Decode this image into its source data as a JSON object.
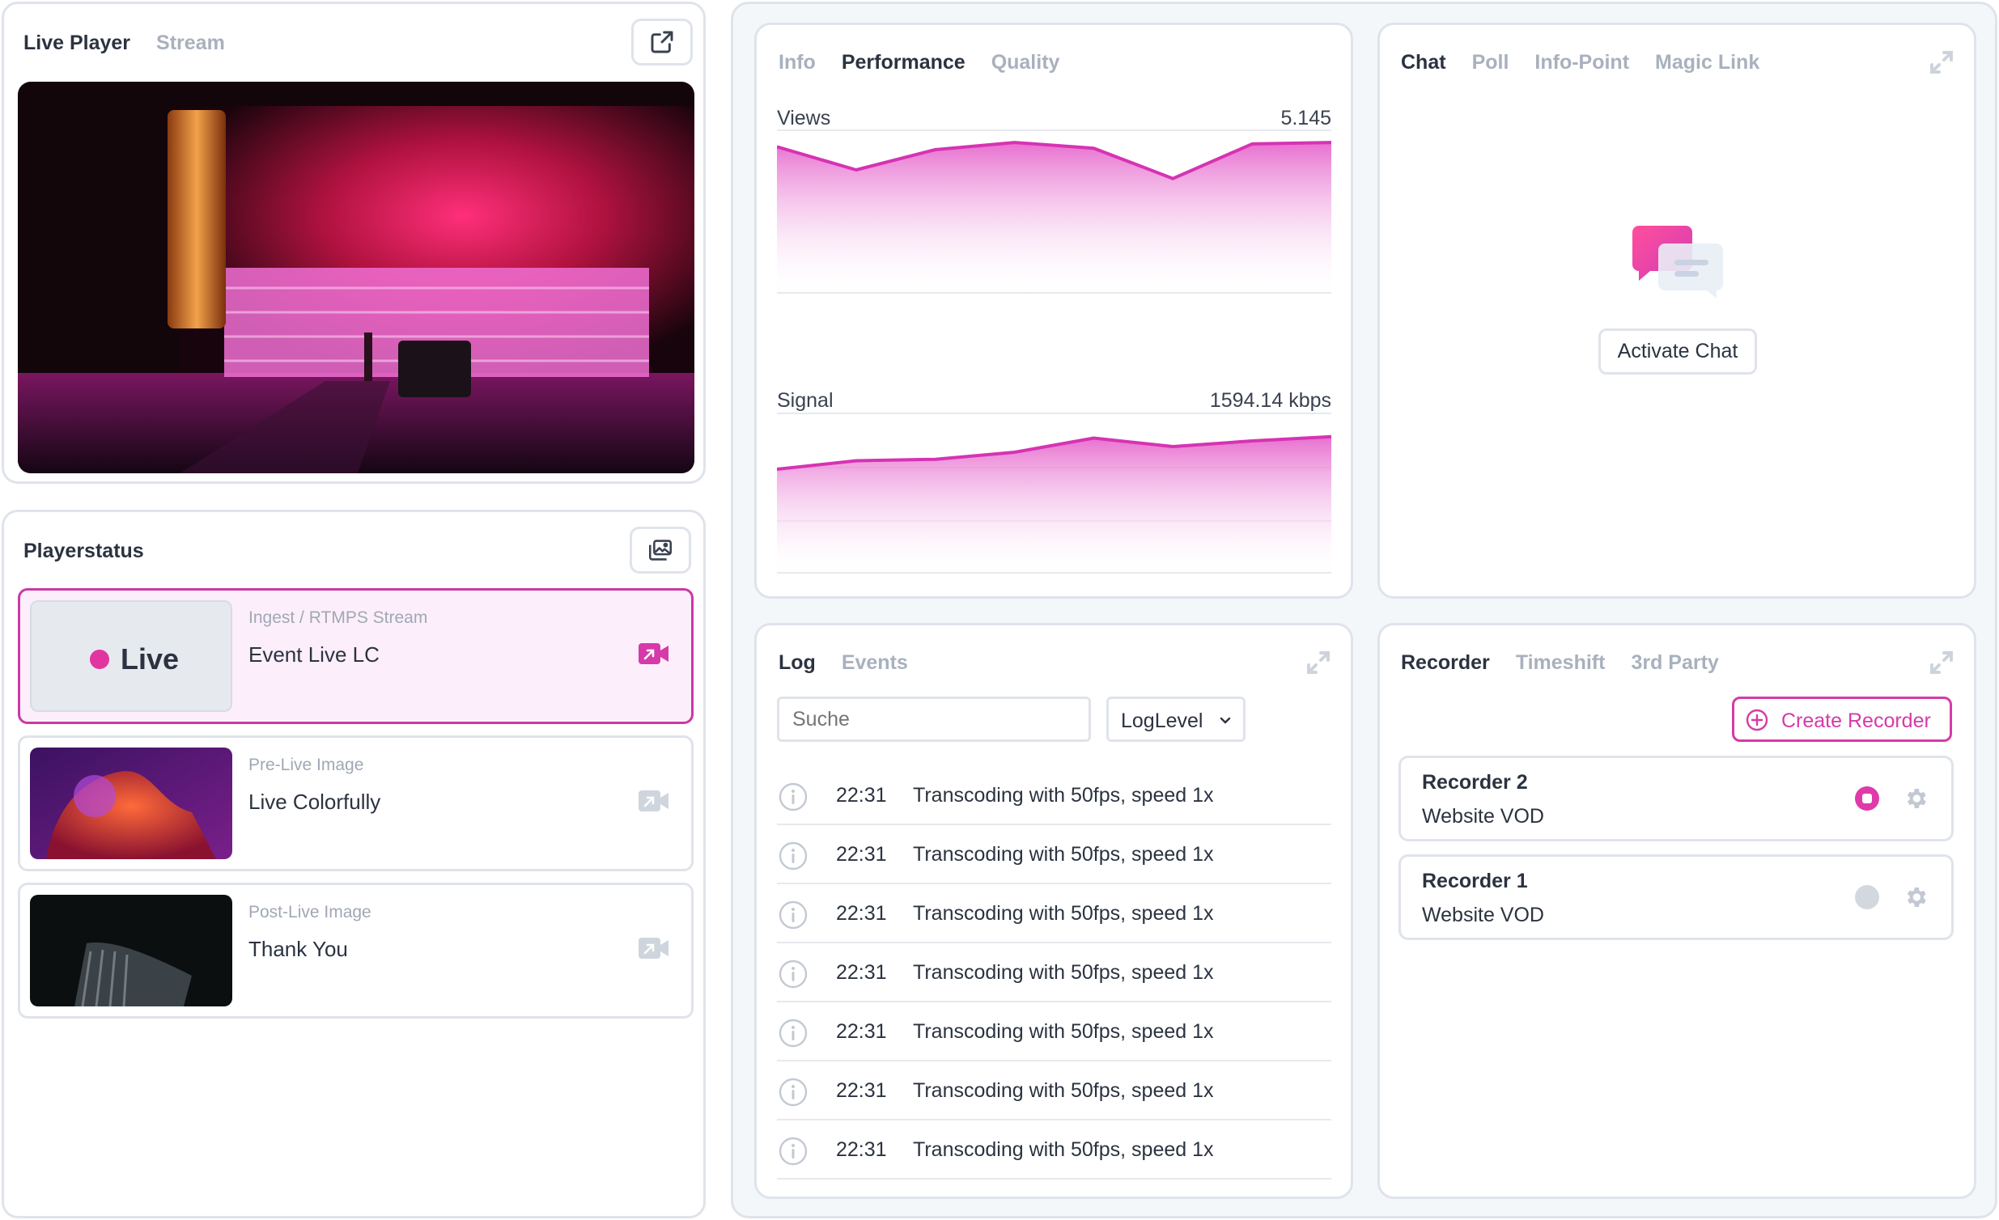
{
  "player": {
    "tabs": [
      {
        "label": "Live Player",
        "active": true
      },
      {
        "label": "Stream",
        "active": false
      }
    ],
    "open_external_icon": "external-link-icon"
  },
  "playerstatus": {
    "title": "Playerstatus",
    "gallery_icon": "image-gallery-icon",
    "cards": [
      {
        "thumb_label": "Live",
        "subtitle": "Ingest / RTMPS Stream",
        "title": "Event Live LC",
        "active": true
      },
      {
        "subtitle": "Pre-Live Image",
        "title": "Live Colorfully",
        "active": false
      },
      {
        "subtitle": "Post-Live Image",
        "title": "Thank You",
        "active": false
      }
    ]
  },
  "performance": {
    "tabs": [
      {
        "label": "Info",
        "active": false
      },
      {
        "label": "Performance",
        "active": true
      },
      {
        "label": "Quality",
        "active": false
      }
    ],
    "views": {
      "label": "Views",
      "value": "5.145"
    },
    "signal": {
      "label": "Signal",
      "value": "1594.14 kbps"
    }
  },
  "chat": {
    "tabs": [
      {
        "label": "Chat",
        "active": true
      },
      {
        "label": "Poll",
        "active": false
      },
      {
        "label": "Info-Point",
        "active": false
      },
      {
        "label": "Magic Link",
        "active": false
      }
    ],
    "activate_label": "Activate Chat"
  },
  "log": {
    "tabs": [
      {
        "label": "Log",
        "active": true
      },
      {
        "label": "Events",
        "active": false
      }
    ],
    "search_placeholder": "Suche",
    "loglevel_label": "LogLevel",
    "rows": [
      {
        "time": "22:31",
        "message": "Transcoding with 50fps, speed 1x"
      },
      {
        "time": "22:31",
        "message": "Transcoding with 50fps, speed 1x"
      },
      {
        "time": "22:31",
        "message": "Transcoding with 50fps, speed 1x"
      },
      {
        "time": "22:31",
        "message": "Transcoding with 50fps, speed 1x"
      },
      {
        "time": "22:31",
        "message": "Transcoding with 50fps, speed 1x"
      },
      {
        "time": "22:31",
        "message": "Transcoding with 50fps, speed 1x"
      },
      {
        "time": "22:31",
        "message": "Transcoding with 50fps, speed 1x"
      }
    ]
  },
  "recorder": {
    "tabs": [
      {
        "label": "Recorder",
        "active": true
      },
      {
        "label": "Timeshift",
        "active": false
      },
      {
        "label": "3rd Party",
        "active": false
      }
    ],
    "create_label": "Create Recorder",
    "items": [
      {
        "name": "Recorder 2",
        "target": "Website VOD",
        "recording": true
      },
      {
        "name": "Recorder 1",
        "target": "Website VOD",
        "recording": false
      }
    ]
  },
  "colors": {
    "accent": "#d63aa8",
    "border": "#dfe3ea",
    "muted": "#a8b1bd",
    "text": "#2b3340"
  },
  "chart_data": [
    {
      "type": "area",
      "title": "Views",
      "x": [
        0,
        1,
        2,
        3,
        4,
        5,
        6,
        7
      ],
      "values": [
        5.0,
        4.2,
        4.9,
        5.15,
        4.95,
        3.9,
        5.1,
        5.15
      ]
    },
    {
      "type": "area",
      "title": "Signal",
      "x": [
        0,
        1,
        2,
        3,
        4,
        5,
        6,
        7
      ],
      "values": [
        3.6,
        3.9,
        3.95,
        4.2,
        4.7,
        4.4,
        4.6,
        4.75
      ]
    }
  ]
}
